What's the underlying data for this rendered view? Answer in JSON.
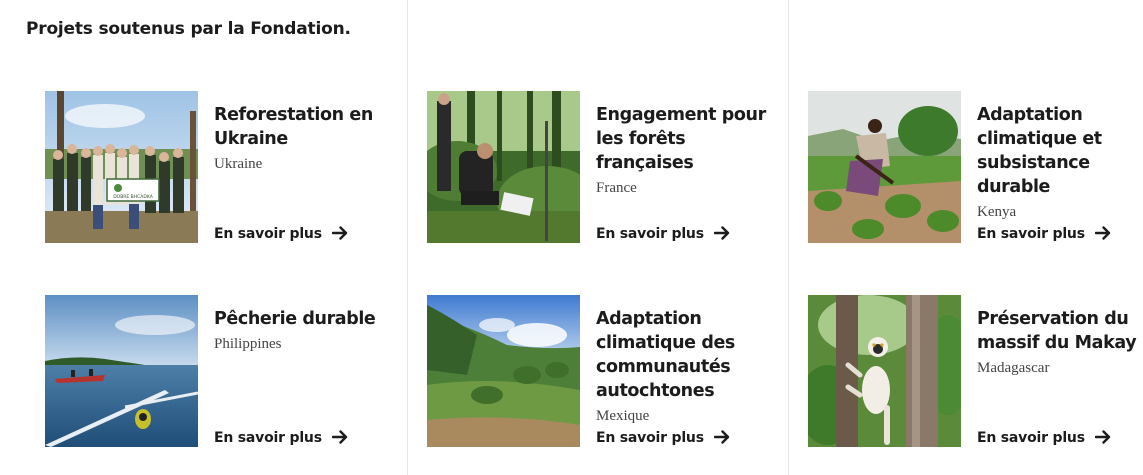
{
  "section": {
    "title": "Projets soutenus par la Fondation."
  },
  "cards": [
    {
      "title": "Reforestation en Ukraine",
      "country": "Ukraine",
      "link": "En savoir plus",
      "banner": "DOBRE BHCADKA"
    },
    {
      "title": "Engagement pour les forêts françaises",
      "country": "France",
      "link": "En savoir plus"
    },
    {
      "title": "Adaptation climatique et subsistance durable",
      "country": "Kenya",
      "link": "En savoir plus"
    },
    {
      "title": "Pêcherie durable",
      "country": "Philippines",
      "link": "En savoir plus"
    },
    {
      "title": "Adaptation climatique des communautés autochtones",
      "country": "Mexique",
      "link": "En savoir plus"
    },
    {
      "title": "Préservation du massif du Makay",
      "country": "Madagascar",
      "link": "En savoir plus"
    }
  ],
  "icons": {
    "link_arrow": "arrow-right-icon"
  },
  "colors": {
    "text": "#1c1c1c",
    "country": "#444444",
    "divider": "#e6e6e6",
    "background": "#ffffff"
  }
}
